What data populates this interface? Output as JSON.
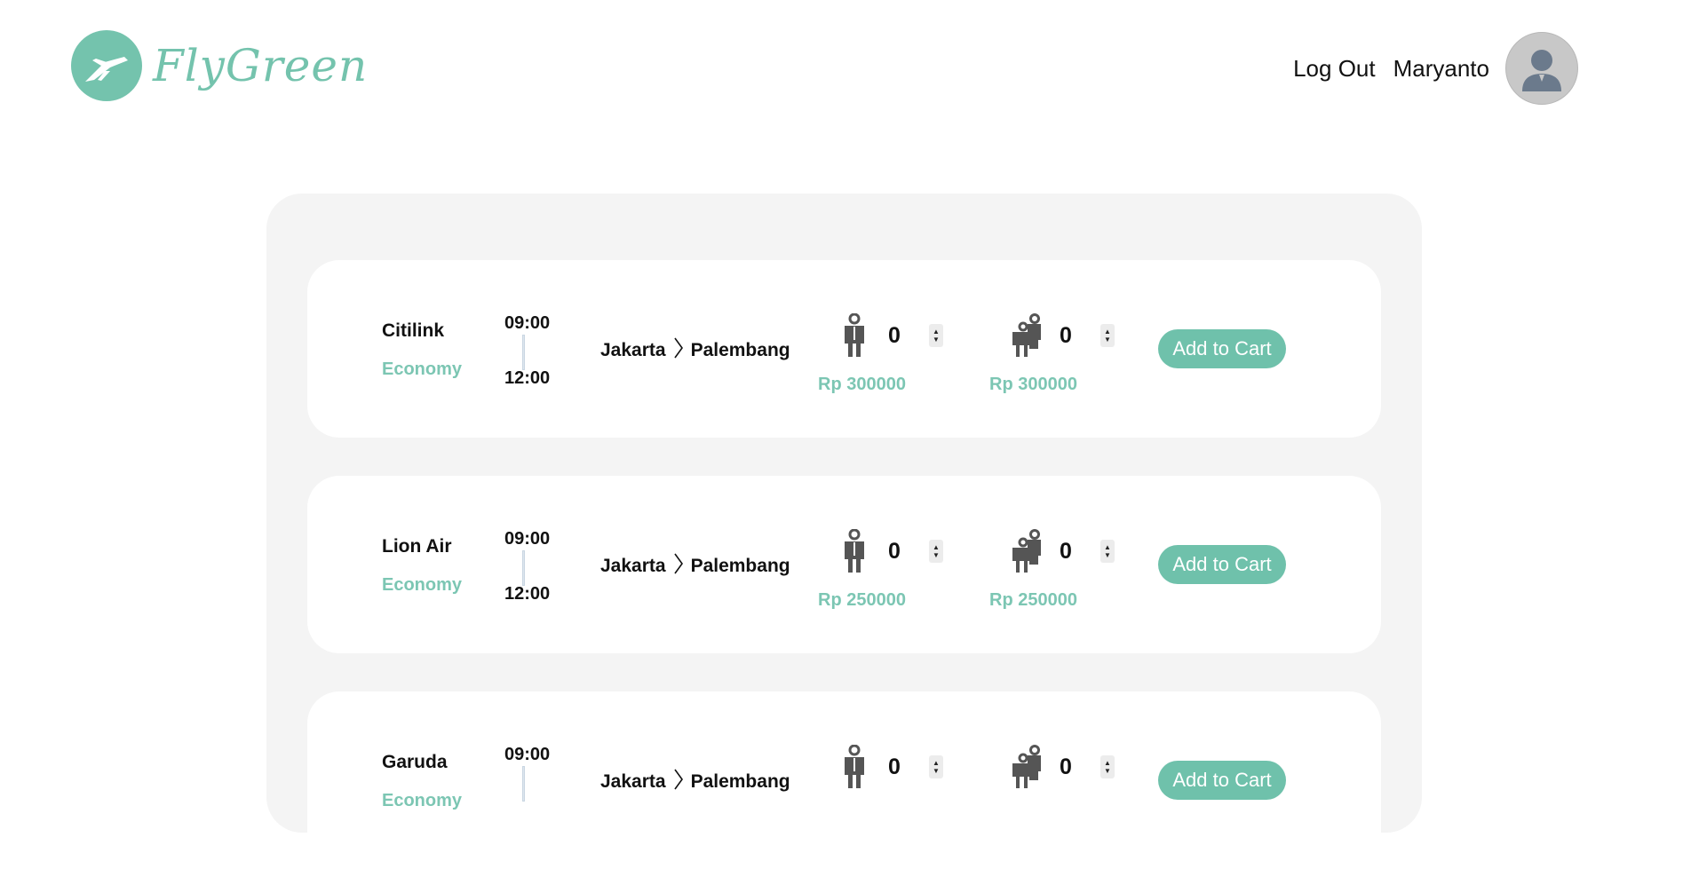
{
  "brand": {
    "name": "FlyGreen",
    "color": "#74c3ad"
  },
  "nav": {
    "logout_label": "Log Out",
    "user_name": "Maryanto"
  },
  "flights": [
    {
      "airline": "Citilink",
      "class": "Economy",
      "departure": "09:00",
      "arrival": "12:00",
      "origin": "Jakarta",
      "destination": "Palembang",
      "adult": {
        "qty": "0",
        "price": "Rp 300000"
      },
      "child": {
        "qty": "0",
        "price": "Rp 300000"
      },
      "cart_label": "Add to Cart"
    },
    {
      "airline": "Lion Air",
      "class": "Economy",
      "departure": "09:00",
      "arrival": "12:00",
      "origin": "Jakarta",
      "destination": "Palembang",
      "adult": {
        "qty": "0",
        "price": "Rp 250000"
      },
      "child": {
        "qty": "0",
        "price": "Rp 250000"
      },
      "cart_label": "Add to Cart"
    },
    {
      "airline": "Garuda",
      "class": "Economy",
      "departure": "09:00",
      "arrival": "",
      "origin": "Jakarta",
      "destination": "Palembang",
      "adult": {
        "qty": "0",
        "price": ""
      },
      "child": {
        "qty": "0",
        "price": ""
      },
      "cart_label": "Add to Cart"
    }
  ],
  "icons": {
    "logo": "plane-logo-icon",
    "avatar": "user-avatar-icon",
    "adult": "adult-person-icon",
    "child": "parent-child-icon",
    "route_separator": "chevron-right-icon",
    "stepper": "up-down-stepper-icon"
  }
}
